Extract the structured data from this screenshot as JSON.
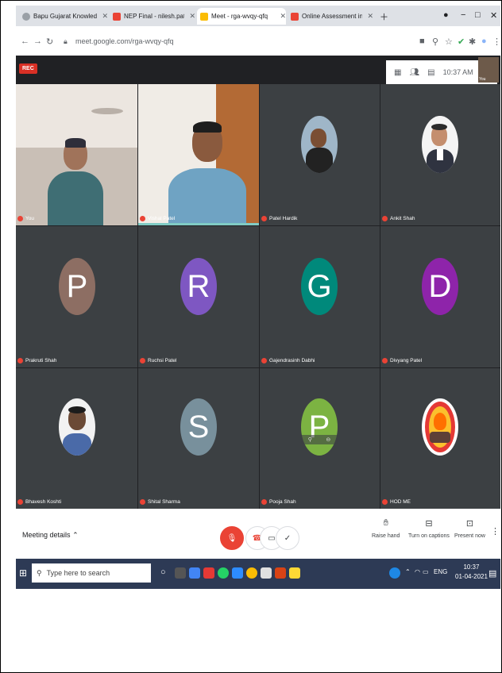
{
  "tabs": [
    {
      "title": "Bapu Gujarat Knowledge Village",
      "color": "#5f6368"
    },
    {
      "title": "NEP Final - nilesh.patel@bapugi",
      "color": "#ea4335"
    },
    {
      "title": "Meet - rga-wvqy-qfq",
      "color": "#fbbc04"
    },
    {
      "title": "Online Assessment in DIPLOMA",
      "color": "#ea4335"
    }
  ],
  "address": {
    "url": "meet.google.com/rga-wvqy-qfq"
  },
  "meet": {
    "rec_label": "REC",
    "time": "10:37 AM",
    "self_label": "You"
  },
  "participants": [
    {
      "name": "You",
      "kind": "video"
    },
    {
      "name": "Vishal Patel",
      "kind": "video"
    },
    {
      "name": "Patel Hardik",
      "kind": "photo"
    },
    {
      "name": "Ankit Shah",
      "kind": "photo"
    },
    {
      "name": "Prakruti Shah",
      "kind": "letter",
      "letter": "P",
      "color": "#8d6e63"
    },
    {
      "name": "Ruchsi Patel",
      "kind": "letter",
      "letter": "R",
      "color": "#7e57c2"
    },
    {
      "name": "Gajendrasinh Dabhi",
      "kind": "letter",
      "letter": "G",
      "color": "#00897b"
    },
    {
      "name": "Divyang Patel",
      "kind": "letter",
      "letter": "D",
      "color": "#8e24aa"
    },
    {
      "name": "Bhavesh Koshti",
      "kind": "photo"
    },
    {
      "name": "Shital Sharma",
      "kind": "letter",
      "letter": "S",
      "color": "#78909c"
    },
    {
      "name": "Pooja Shah",
      "kind": "letter",
      "letter": "P",
      "color": "#7cb342"
    },
    {
      "name": "HOD ME",
      "kind": "logo"
    }
  ],
  "controls": {
    "meeting_details": "Meeting details",
    "raise_hand": "Raise hand",
    "captions": "Turn on captions",
    "present": "Present now"
  },
  "taskbar": {
    "search_placeholder": "Type here to search",
    "lang": "ENG",
    "clock_time": "10:37",
    "clock_date": "01-04-2021"
  }
}
